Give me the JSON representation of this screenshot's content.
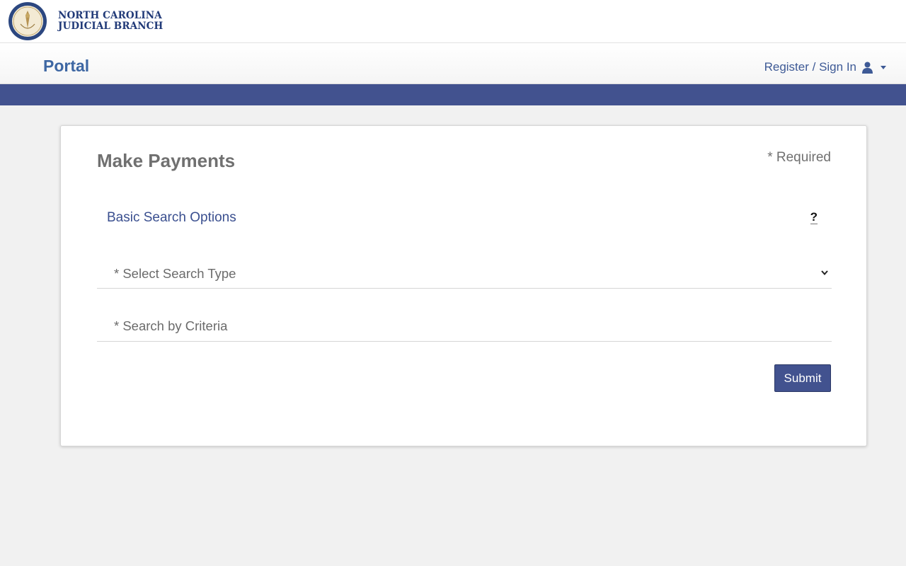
{
  "brand": {
    "line1": "NORTH CAROLINA",
    "line2": "JUDICIAL BRANCH",
    "seal_icon": "court-seal-icon"
  },
  "nav": {
    "portal_label": "Portal",
    "signin_label": "Register / Sign In",
    "user_icon": "user-icon",
    "caret_icon": "caret-down-icon"
  },
  "colors": {
    "accent": "#42528f",
    "link": "#3e67a3",
    "brand_text": "#213a78",
    "background": "#f1f1f1"
  },
  "form": {
    "title": "Make Payments",
    "required_note": "* Required",
    "section_title": "Basic Search Options",
    "help_label": "?",
    "search_type_placeholder": "* Select Search Type",
    "criteria_placeholder": "* Search by Criteria",
    "submit_label": "Submit"
  }
}
